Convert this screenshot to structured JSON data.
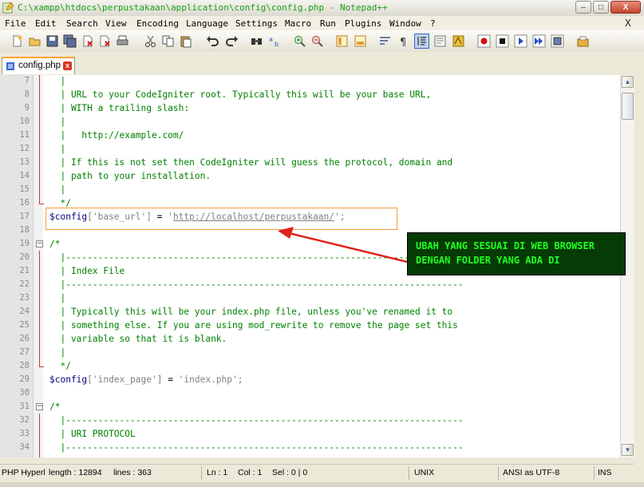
{
  "window": {
    "title": "C:\\xampp\\htdocs\\perpustakaan\\application\\config\\config.php - Notepad++",
    "btn_min": "–",
    "btn_max": "□",
    "btn_close": "X"
  },
  "menu": {
    "items": [
      "File",
      "Edit",
      "Search",
      "View",
      "Encoding",
      "Language",
      "Settings",
      "Macro",
      "Run",
      "Plugins",
      "Window",
      "?"
    ],
    "close": "X"
  },
  "tab": {
    "name": "config.php",
    "close": "x"
  },
  "lines": [
    {
      "n": "7",
      "t": "  |"
    },
    {
      "n": "8",
      "t": "  | URL to your CodeIgniter root. Typically this will be your base URL,"
    },
    {
      "n": "9",
      "t": "  | WITH a trailing slash:"
    },
    {
      "n": "10",
      "t": "  |"
    },
    {
      "n": "11",
      "t": "  |   http://example.com/"
    },
    {
      "n": "12",
      "t": "  |"
    },
    {
      "n": "13",
      "t": "  | If this is not set then CodeIgniter will guess the protocol, domain and"
    },
    {
      "n": "14",
      "t": "  | path to your installation."
    },
    {
      "n": "15",
      "t": "  |"
    },
    {
      "n": "16",
      "t": "  */"
    },
    {
      "n": "17",
      "t": "$config['base_url'] = 'http://localhost/perpustakaan/';"
    },
    {
      "n": "18",
      "t": ""
    },
    {
      "n": "19",
      "t": "/*"
    },
    {
      "n": "20",
      "t": "  |--------------------------------------------------------------------------"
    },
    {
      "n": "21",
      "t": "  | Index File"
    },
    {
      "n": "22",
      "t": "  |--------------------------------------------------------------------------"
    },
    {
      "n": "23",
      "t": "  |"
    },
    {
      "n": "24",
      "t": "  | Typically this will be your index.php file, unless you've renamed it to"
    },
    {
      "n": "25",
      "t": "  | something else. If you are using mod_rewrite to remove the page set this"
    },
    {
      "n": "26",
      "t": "  | variable so that it is blank."
    },
    {
      "n": "27",
      "t": "  |"
    },
    {
      "n": "28",
      "t": "  */"
    },
    {
      "n": "29",
      "t": "$config['index_page'] = 'index.php';"
    },
    {
      "n": "30",
      "t": ""
    },
    {
      "n": "31",
      "t": "/*"
    },
    {
      "n": "32",
      "t": "  |--------------------------------------------------------------------------"
    },
    {
      "n": "33",
      "t": "  | URI PROTOCOL"
    },
    {
      "n": "34",
      "t": "  |--------------------------------------------------------------------------"
    }
  ],
  "code17": {
    "var": "$config",
    "key": "['base_url']",
    "eq": " = ",
    "q1": "'",
    "url": "http://localhost/perpustakaan/",
    "q2": "';"
  },
  "code29": {
    "var": "$config",
    "key": "['index_page']",
    "eq": " = ",
    "val": "'index.php';"
  },
  "annotation": {
    "text": "UBAH YANG SESUAI DI WEB BROWSER\nDENGAN FOLDER YANG ADA DI",
    "color": "#22ff22",
    "background": "#063b06"
  },
  "status": {
    "file_type": "PHP Hyperl",
    "length": "length : 12894",
    "lines": "lines : 363",
    "ln": "Ln : 1",
    "col": "Col : 1",
    "sel": "Sel : 0 | 0",
    "eol": "UNIX",
    "encoding": "ANSI as UTF-8",
    "ins": "INS"
  },
  "colors": {
    "comment": "#008000",
    "variable": "#000080",
    "string": "#808080",
    "highlight_border": "#f39a3d",
    "arrow": "#e0201a"
  }
}
